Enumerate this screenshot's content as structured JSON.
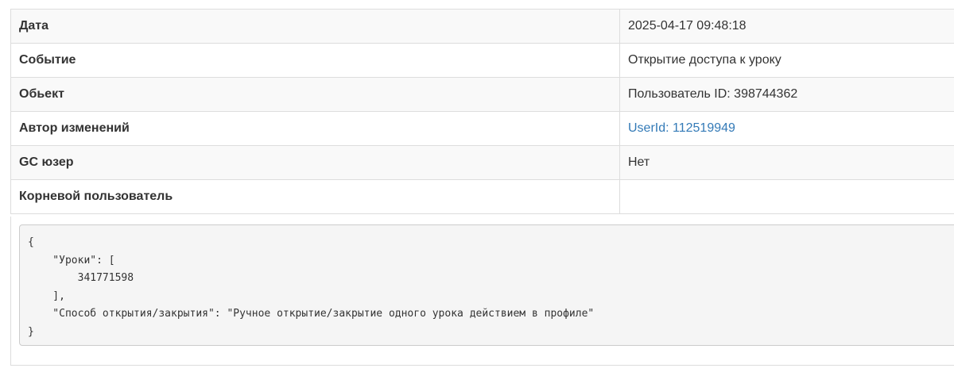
{
  "details": {
    "rows": [
      {
        "label": "Дата",
        "value": "2025-04-17 09:48:18"
      },
      {
        "label": "Событие",
        "value": "Открытие доступа к уроку"
      },
      {
        "label": "Обьект",
        "value": "Пользователь ID: 398744362"
      },
      {
        "label": "Автор изменений",
        "value": "UserId: 112519949"
      },
      {
        "label": "GC юзер",
        "value": "Нет"
      },
      {
        "label": "Корневой пользователь",
        "value": ""
      }
    ]
  },
  "payload": {
    "json_text": "{\n    \"Уроки\": [\n        341771598\n    ],\n    \"Способ открытия/закрытия\": \"Ручное открытие/закрытие одного урока действием в профиле\"\n}"
  },
  "colors": {
    "link": "#337ab7",
    "border": "#dddddd",
    "stripe": "#f9f9f9",
    "code_background": "#f5f5f5"
  }
}
